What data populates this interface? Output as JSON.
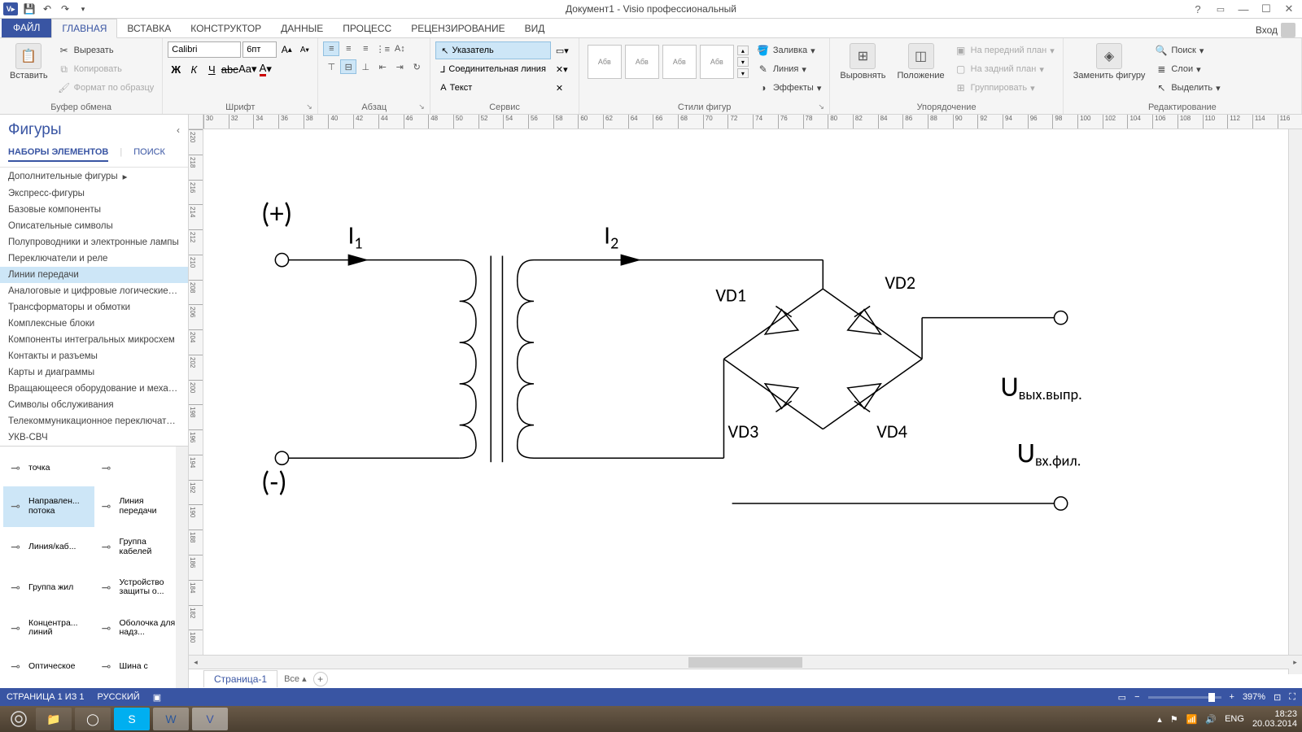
{
  "title": "Документ1 - Visio профессиональный",
  "login_label": "Вход",
  "tabs": {
    "file": "ФАЙЛ",
    "home": "ГЛАВНАЯ",
    "insert": "ВСТАВКА",
    "design": "КОНСТРУКТОР",
    "data": "ДАННЫЕ",
    "process": "ПРОЦЕСС",
    "review": "РЕЦЕНЗИРОВАНИЕ",
    "view": "ВИД"
  },
  "ribbon": {
    "clipboard": {
      "paste": "Вставить",
      "cut": "Вырезать",
      "copy": "Копировать",
      "format_painter": "Формат по образцу",
      "label": "Буфер обмена"
    },
    "font": {
      "name": "Calibri",
      "size": "6пт",
      "label": "Шрифт"
    },
    "paragraph": {
      "label": "Абзац"
    },
    "tools": {
      "pointer": "Указатель",
      "connector": "Соединительная линия",
      "text": "Текст",
      "label": "Сервис"
    },
    "styles": {
      "sample": "Абв",
      "label": "Стили фигур",
      "fill": "Заливка",
      "line": "Линия",
      "effects": "Эффекты"
    },
    "arrange": {
      "align": "Выровнять",
      "position": "Положение",
      "front": "На передний план",
      "back": "На задний план",
      "group": "Группировать",
      "label": "Упорядочение"
    },
    "edit": {
      "change_shape": "Заменить фигуру",
      "find": "Поиск",
      "layers": "Слои",
      "select": "Выделить",
      "label": "Редактирование"
    }
  },
  "shapes": {
    "title": "Фигуры",
    "tab_sets": "НАБОРЫ ЭЛЕМЕНТОВ",
    "tab_search": "ПОИСК",
    "more": "Дополнительные фигуры",
    "stencils": [
      "Экспресс-фигуры",
      "Базовые компоненты",
      "Описательные символы",
      "Полупроводники и электронные лампы",
      "Переключатели и реле",
      "Линии передачи",
      "Аналоговые и цифровые логические ком...",
      "Трансформаторы и обмотки",
      "Комплексные блоки",
      "Компоненты интегральных микросхем",
      "Контакты и разъемы",
      "Карты и диаграммы",
      "Вращающееся оборудование и механиче...",
      "Символы обслуживания",
      "Телекоммуникационное переключательн...",
      "УКВ-СВЧ"
    ],
    "selected_stencil_index": 5,
    "grid": [
      {
        "name": "точка"
      },
      {
        "name": ""
      },
      {
        "name": "Направлен... потока",
        "sel": true
      },
      {
        "name": "Линия передачи"
      },
      {
        "name": "Линия/каб..."
      },
      {
        "name": "Группа кабелей"
      },
      {
        "name": "Группа жил"
      },
      {
        "name": "Устройство защиты о..."
      },
      {
        "name": "Концентра... линий"
      },
      {
        "name": "Оболочка для надз..."
      },
      {
        "name": "Оптическое"
      },
      {
        "name": "Шина с"
      }
    ]
  },
  "ruler_h": [
    "30",
    "32",
    "34",
    "36",
    "38",
    "40",
    "42",
    "44",
    "46",
    "48",
    "50",
    "52",
    "54",
    "56",
    "58",
    "60",
    "62",
    "64",
    "66",
    "68",
    "70",
    "72",
    "74",
    "76",
    "78",
    "80",
    "82",
    "84",
    "86",
    "88",
    "90",
    "92",
    "94",
    "96",
    "98",
    "100",
    "102",
    "104",
    "106",
    "108",
    "110",
    "112",
    "114",
    "116"
  ],
  "ruler_v": [
    "220",
    "218",
    "216",
    "214",
    "212",
    "210",
    "208",
    "206",
    "204",
    "202",
    "200",
    "198",
    "196",
    "194",
    "192",
    "190",
    "188",
    "186",
    "184",
    "182",
    "180"
  ],
  "diagram": {
    "plus": "(+)",
    "minus": "(-)",
    "i1": "I",
    "i1sub": "1",
    "i2": "I",
    "i2sub": "2",
    "vd1": "VD1",
    "vd2": "VD2",
    "vd3": "VD3",
    "vd4": "VD4",
    "u1": "U",
    "u1sub": "вых.выпр.",
    "u2": "U",
    "u2sub": "вх.фил."
  },
  "pages": {
    "page1": "Страница-1",
    "all": "Все"
  },
  "status": {
    "page": "СТРАНИЦА 1 ИЗ 1",
    "lang": "РУССКИЙ",
    "zoom": "397%"
  },
  "tray": {
    "lang": "ENG",
    "time": "18:23",
    "date": "20.03.2014"
  }
}
